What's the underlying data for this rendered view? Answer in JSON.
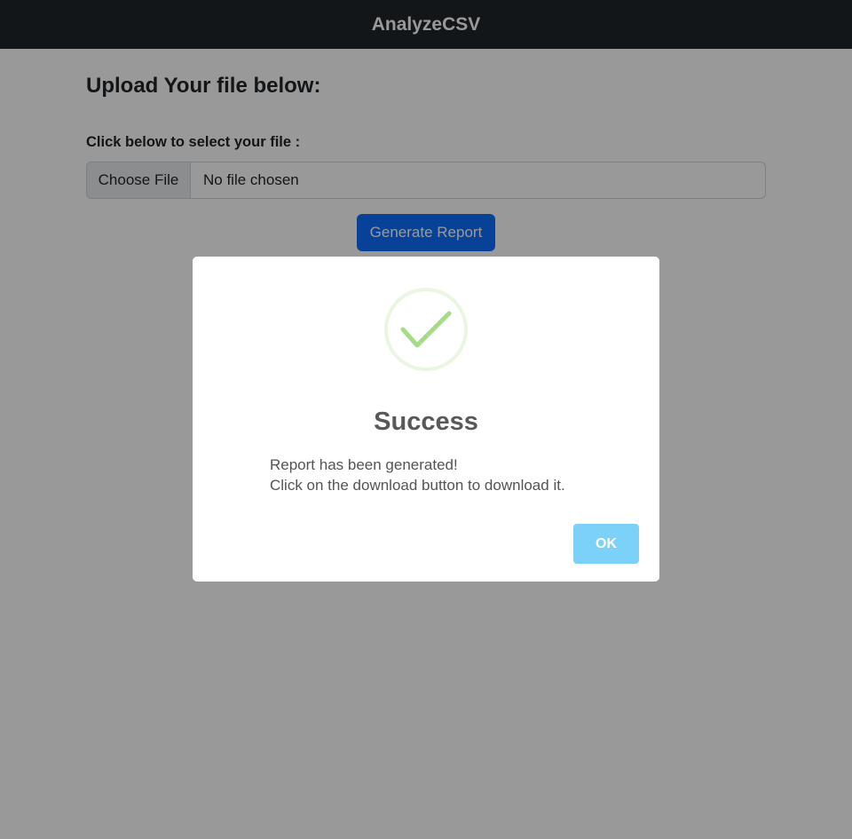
{
  "navbar": {
    "brand": "AnalyzeCSV"
  },
  "main": {
    "heading": "Upload Your file below:",
    "file_label": "Click below to select your file :",
    "file_input": {
      "button_label": "Choose File",
      "status": "No file chosen"
    },
    "generate_button": "Generate Report"
  },
  "modal": {
    "icon": "success-check-icon",
    "title": "Success",
    "line1": "Report has been generated!",
    "line2": "Click on the download button to download it.",
    "ok_button": "OK"
  },
  "colors": {
    "navbar": "#212529",
    "primary": "#0d6efd",
    "success": "#a5dc86",
    "ok_button": "#7cd1f9"
  }
}
